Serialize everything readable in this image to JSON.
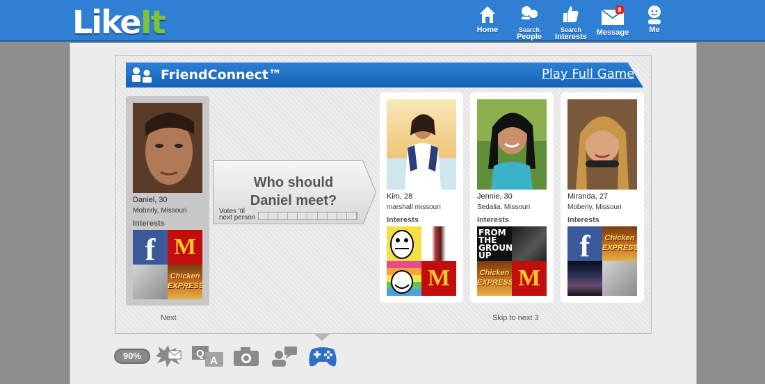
{
  "header": {
    "logo": {
      "like": "Like",
      "it": "It"
    },
    "nav": [
      {
        "id": "home",
        "label": "Home"
      },
      {
        "id": "search-people",
        "label_line1": "Search",
        "label_line2": "People"
      },
      {
        "id": "search-interests",
        "label_line1": "Search",
        "label_line2": "Interests"
      },
      {
        "id": "message",
        "label": "Message",
        "badge": "8"
      },
      {
        "id": "me",
        "label": "Me"
      }
    ]
  },
  "game": {
    "title": "FriendConnect™",
    "play_link": "Play Full Game",
    "player": {
      "name_age": "Daniel, 30",
      "location": "Moberly, Missouri",
      "interests_label": "Interests",
      "interests": [
        "facebook",
        "mcdonalds",
        "gray-album",
        "chicken-express"
      ]
    },
    "question": {
      "line1": "Who should",
      "line2": "Daniel meet?"
    },
    "votes_label_1": "Votes 'til",
    "votes_label_2": "next person",
    "votes_progress": 0,
    "candidates": [
      {
        "name_age": "Kim, 28",
        "location": "marshall missouri",
        "interests_label": "Interests",
        "interests": [
          "rage-face",
          "bottle",
          "rainbow",
          "mcdonalds"
        ]
      },
      {
        "name_age": "Jennie, 30",
        "location": "Sedalia, Missouri",
        "interests_label": "Interests",
        "interests": [
          "from-the-ground-up",
          "dark-portrait",
          "chicken-express",
          "mcdonalds"
        ]
      },
      {
        "name_age": "Miranda, 27",
        "location": "Moberly, Missouri",
        "interests_label": "Interests",
        "interests": [
          "facebook",
          "chicken-express",
          "album",
          "gray-album"
        ]
      }
    ],
    "tile_text": {
      "fb": "f",
      "mc": "M",
      "chicken": "Chicken EXPRESS",
      "ground": "FROM THE GROUND UP"
    },
    "next_label": "Next",
    "skip_label": "Skip to next 3"
  },
  "toolbar": {
    "percent": "90%",
    "icons": [
      "splat-message-icon",
      "qa-icon",
      "camera-icon",
      "chat-people-icon",
      "gamepad-icon"
    ]
  },
  "colors": {
    "topbar": "#2f7fd2",
    "banner": "#1662b8",
    "logo_green": "#7dc33b"
  }
}
